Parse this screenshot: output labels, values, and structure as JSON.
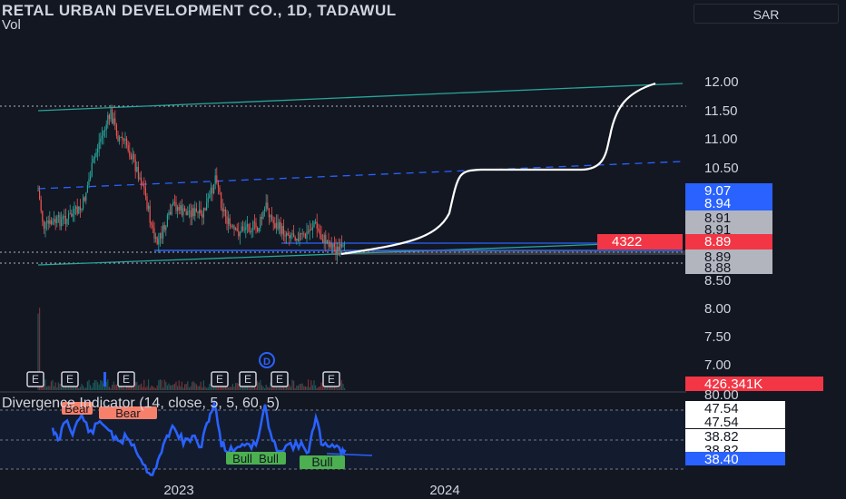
{
  "header": {
    "title": "RETAL URBAN DEVELOPMENT CO., 1D, TADAWUL",
    "volume_label": "Vol",
    "currency": "SAR"
  },
  "chart_data": [
    {
      "type": "candlestick",
      "title": "RETAL URBAN DEVELOPMENT CO., 1D, TADAWUL",
      "y_ticks": [
        "12.00",
        "11.50",
        "11.00",
        "10.50",
        "8.50",
        "8.00",
        "7.50",
        "7.00"
      ],
      "x_ticks": [
        "2023",
        "2024"
      ],
      "price_badges": [
        {
          "value": "9.07",
          "color": "#2962ff"
        },
        {
          "value": "8.94",
          "color": "#2962ff"
        },
        {
          "value": "8.91",
          "color": "#b2b5be"
        },
        {
          "value": "8.91",
          "color": "#b2b5be"
        },
        {
          "value": "8.89",
          "color": "#f23645"
        },
        {
          "value": "8.89",
          "color": "#b2b5be"
        },
        {
          "value": "8.88",
          "color": "#b2b5be"
        }
      ],
      "countdown": "4322",
      "volume_badge": "426.341K",
      "event_markers": [
        "E",
        "E",
        "E",
        "E",
        "E",
        "E",
        "E",
        "D"
      ],
      "colors": {
        "up": "#26a69a",
        "down": "#ef5350",
        "channel": "#26a69a",
        "projection": "#ffffff",
        "mid_line": "#2962ff"
      }
    },
    {
      "type": "line",
      "title": "Divergence Indicator (14, close, 5, 5, 60, 5)",
      "y_ticks": [
        "80.00"
      ],
      "value_badges": [
        {
          "value": "47.54",
          "color": "#ffffff"
        },
        {
          "value": "47.54",
          "color": "#ffffff"
        },
        {
          "value": "38.82",
          "color": "#ffffff"
        },
        {
          "value": "38.82",
          "color": "#ffffff"
        },
        {
          "value": "38.40",
          "color": "#2962ff"
        }
      ],
      "labels": [
        {
          "text": "Bear",
          "color": "#f7806a"
        },
        {
          "text": "Bear",
          "color": "#f7806a"
        },
        {
          "text": "Bull",
          "color": "#4caf50"
        },
        {
          "text": "Bull",
          "color": "#4caf50"
        },
        {
          "text": "Bull",
          "color": "#4caf50"
        }
      ],
      "series_color": "#2962ff"
    }
  ]
}
